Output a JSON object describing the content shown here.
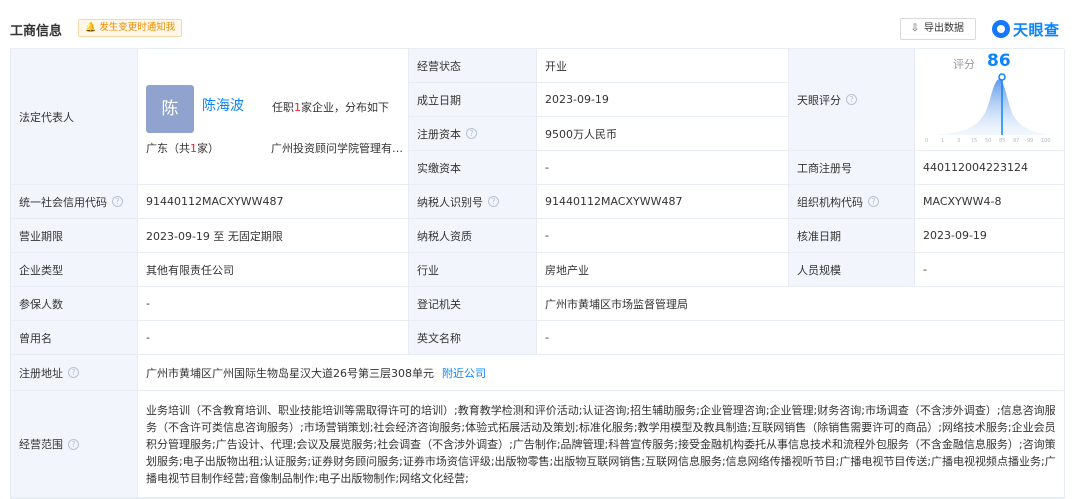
{
  "header": {
    "title": "工商信息",
    "notify_label": "发生变更时通知我",
    "export_label": "导出数据",
    "brand": "天眼查"
  },
  "legal_rep": {
    "label": "法定代表人",
    "avatar_char": "陈",
    "name": "陈海波",
    "office_prefix": "任职",
    "office_count": "1",
    "office_suffix": "家企业，分布如下",
    "region_prefix": "广东（共",
    "region_count": "1",
    "region_suffix": "家）",
    "company": "广州投资顾问学院管理有限公司"
  },
  "score": {
    "label": "天眼评分",
    "title": "评分",
    "value": "86",
    "ticks": [
      "0",
      "1",
      "3",
      "15",
      "50",
      "85",
      "97",
      "99",
      "100"
    ]
  },
  "fields": {
    "status_label": "经营状态",
    "status_value": "开业",
    "founded_label": "成立日期",
    "founded_value": "2023-09-19",
    "capital_label": "注册资本",
    "capital_value": "9500万人民币",
    "paid_label": "实缴资本",
    "paid_value": "-",
    "regno_label": "工商注册号",
    "regno_value": "440112004223124",
    "credit_label": "统一社会信用代码",
    "credit_value": "91440112MACXYWW487",
    "taxid_label": "纳税人识别号",
    "taxid_value": "91440112MACXYWW487",
    "orgcode_label": "组织机构代码",
    "orgcode_value": "MACXYWW4-8",
    "term_label": "营业期限",
    "term_value": "2023-09-19 至 无固定期限",
    "taxqual_label": "纳税人资质",
    "taxqual_value": "-",
    "approved_label": "核准日期",
    "approved_value": "2023-09-19",
    "type_label": "企业类型",
    "type_value": "其他有限责任公司",
    "industry_label": "行业",
    "industry_value": "房地产业",
    "staff_label": "人员规模",
    "staff_value": "-",
    "insured_label": "参保人数",
    "insured_value": "-",
    "authority_label": "登记机关",
    "authority_value": "广州市黄埔区市场监督管理局",
    "former_label": "曾用名",
    "former_value": "-",
    "english_label": "英文名称",
    "english_value": "-",
    "address_label": "注册地址",
    "address_value": "广州市黄埔区广州国际生物岛星汉大道26号第三层308单元",
    "address_link": "附近公司",
    "scope_label": "经营范围",
    "scope_value": "业务培训（不含教育培训、职业技能培训等需取得许可的培训）;教育教学检测和评价活动;认证咨询;招生辅助服务;企业管理咨询;企业管理;财务咨询;市场调查（不含涉外调查）;信息咨询服务（不含许可类信息咨询服务）;市场营销策划;社会经济咨询服务;体验式拓展活动及策划;标准化服务;教学用模型及教具制造;互联网销售（除销售需要许可的商品）;网络技术服务;企业会员积分管理服务;广告设计、代理;会议及展览服务;社会调查（不含涉外调查）;广告制作;品牌管理;科普宣传服务;接受金融机构委托从事信息技术和流程外包服务（不含金融信息服务）;咨询策划服务;电子出版物出租;认证服务;证券财务顾问服务;证券市场资信评级;出版物零售;出版物互联网销售;互联网信息服务;信息网络传播视听节目;广播电视节目传送;广播电视视频点播业务;广播电视节目制作经营;音像制品制作;电子出版物制作;网络文化经营;"
  }
}
